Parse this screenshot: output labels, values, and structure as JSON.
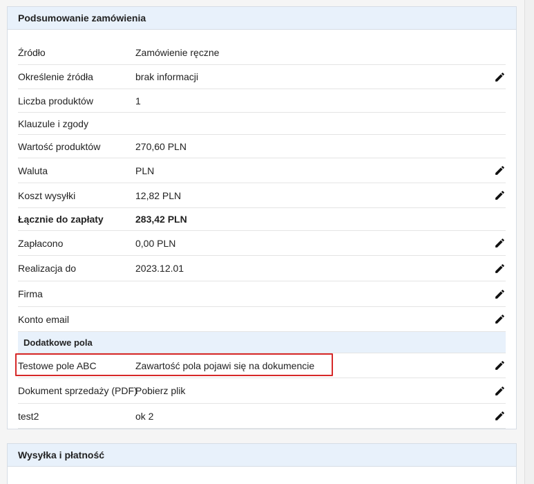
{
  "summary": {
    "title": "Podsumowanie zamówienia",
    "rows": [
      {
        "label": "Źródło",
        "value": "Zamówienie ręczne",
        "editable": false
      },
      {
        "label": "Określenie źródła",
        "value": "brak informacji",
        "editable": true
      },
      {
        "label": "Liczba produktów",
        "value": "1",
        "editable": false
      },
      {
        "label": "Klauzule i zgody",
        "value": "",
        "editable": false
      },
      {
        "label": "Wartość produktów",
        "value": "270,60 PLN",
        "editable": false
      },
      {
        "label": "Waluta",
        "value": "PLN",
        "editable": true
      },
      {
        "label": "Koszt wysyłki",
        "value": "12,82 PLN",
        "editable": true
      },
      {
        "label": "Łącznie do zapłaty",
        "value": "283,42 PLN",
        "editable": false,
        "bold": true
      },
      {
        "label": "Zapłacono",
        "value": "0,00 PLN",
        "editable": true
      },
      {
        "label": "Realizacja do",
        "value": "2023.12.01",
        "editable": true
      },
      {
        "label": "Firma",
        "value": "",
        "editable": true
      },
      {
        "label": "Konto email",
        "value": "",
        "editable": true
      }
    ],
    "extra_section_title": "Dodatkowe pola",
    "extra_rows": [
      {
        "label": "Testowe pole ABC",
        "value": "Zawartość pola pojawi się na dokumencie",
        "editable": true,
        "highlighted": true
      },
      {
        "label": "Dokument sprzedaży (PDF)",
        "value": "Pobierz plik",
        "editable": true
      },
      {
        "label": "test2",
        "value": "ok 2",
        "editable": true
      }
    ]
  },
  "shipping": {
    "title": "Wysyłka i płatność"
  },
  "colors": {
    "header_bg": "#e8f1fb",
    "highlight_border": "#d62828"
  },
  "icons": {
    "edit": "pencil-icon"
  }
}
